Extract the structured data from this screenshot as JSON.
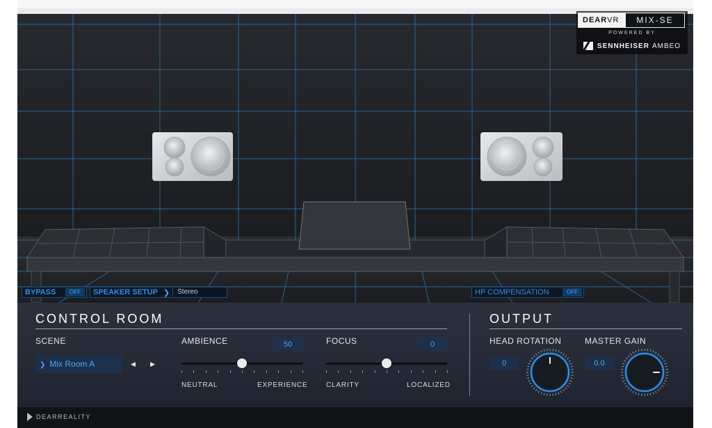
{
  "brand": {
    "dear": "DEAR",
    "vr": "VR",
    "product": "MIX-SE",
    "powered_by": "POWERED BY",
    "sennheiser": "SENNHEISER",
    "ambeo": "AMBEO"
  },
  "toolbar": {
    "bypass_label": "BYPASS",
    "bypass_value": "OFF",
    "speaker_setup_label": "SPEAKER SETUP",
    "speaker_setup_value": "Stereo",
    "hp_comp_label": "HP COMPENSATION",
    "hp_comp_value": "OFF"
  },
  "control_room": {
    "title": "CONTROL ROOM",
    "scene_label": "SCENE",
    "scene_value": "Mix Room A",
    "ambience_label": "AMBIENCE",
    "ambience_value": "50",
    "ambience_level": 0.5,
    "ambience_min_label": "NEUTRAL",
    "ambience_max_label": "EXPERIENCE",
    "focus_label": "FOCUS",
    "focus_value": "0",
    "focus_level": 0.5,
    "focus_min_label": "CLARITY",
    "focus_max_label": "LOCALIZED"
  },
  "output": {
    "title": "OUTPUT",
    "head_rotation_label": "HEAD ROTATION",
    "head_rotation_value": "0",
    "head_rotation_deg": 0,
    "master_gain_label": "MASTER GAIN",
    "master_gain_value": "0.0",
    "master_gain_deg": 90
  },
  "footer": {
    "brand": "DEARREALITY"
  },
  "colors": {
    "accent": "#2b8fe6",
    "grid_line": "#2d6e9e",
    "panel": "#2a2f3b"
  }
}
